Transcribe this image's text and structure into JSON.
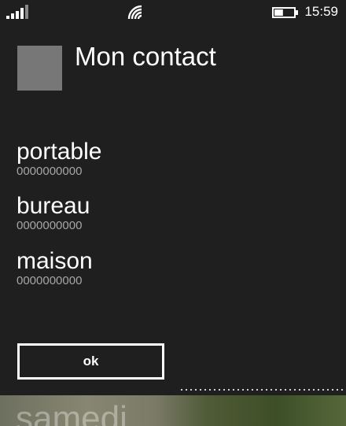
{
  "status_bar": {
    "time": "15:59",
    "icons": [
      "signal-icon",
      "wifi-icon",
      "battery-icon"
    ],
    "battery_level": 0.45
  },
  "contact": {
    "name": "Mon contact"
  },
  "numbers": [
    {
      "label": "portable",
      "number": "0000000000"
    },
    {
      "label": "bureau",
      "number": "0000000000"
    },
    {
      "label": "maison",
      "number": "0000000000"
    }
  ],
  "actions": {
    "ok_label": "ok"
  },
  "background": {
    "day_text": "samedi"
  },
  "colors": {
    "background": "#1f1f1f",
    "text": "#ffffff",
    "secondary_text": "#a6a6a6",
    "avatar": "#777777"
  }
}
